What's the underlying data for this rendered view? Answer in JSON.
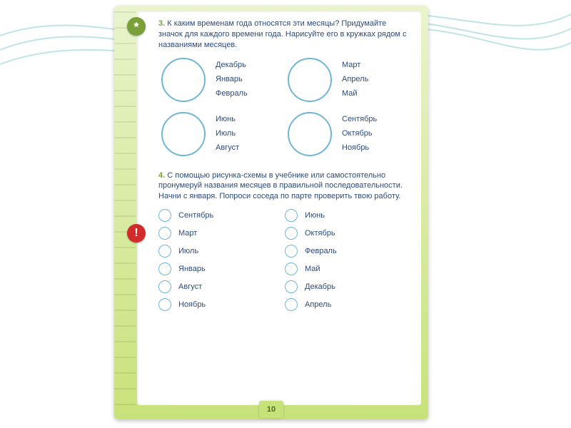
{
  "page_number": "10",
  "task3": {
    "num": "3.",
    "text": "К каким временам года относятся эти месяцы? Придумайте значок для каждого времени года. Нарисуйте его в кружках рядом с названиями месяцев.",
    "groups": [
      [
        "Декабрь",
        "Январь",
        "Февраль"
      ],
      [
        "Март",
        "Апрель",
        "Май"
      ],
      [
        "Июнь",
        "Июль",
        "Август"
      ],
      [
        "Сентябрь",
        "Октябрь",
        "Ноябрь"
      ]
    ]
  },
  "task4": {
    "num": "4.",
    "text": "С помощью рисунка-схемы в учебнике или самостоятельно пронумеруй названия месяцев в правильной последовательности. Начни с января. Попроси соседа по парте проверить твою работу.",
    "col1": [
      "Сентябрь",
      "Март",
      "Июль",
      "Январь",
      "Август",
      "Ноябрь"
    ],
    "col2": [
      "Июнь",
      "Октябрь",
      "Февраль",
      "Май",
      "Декабрь",
      "Апрель"
    ]
  }
}
